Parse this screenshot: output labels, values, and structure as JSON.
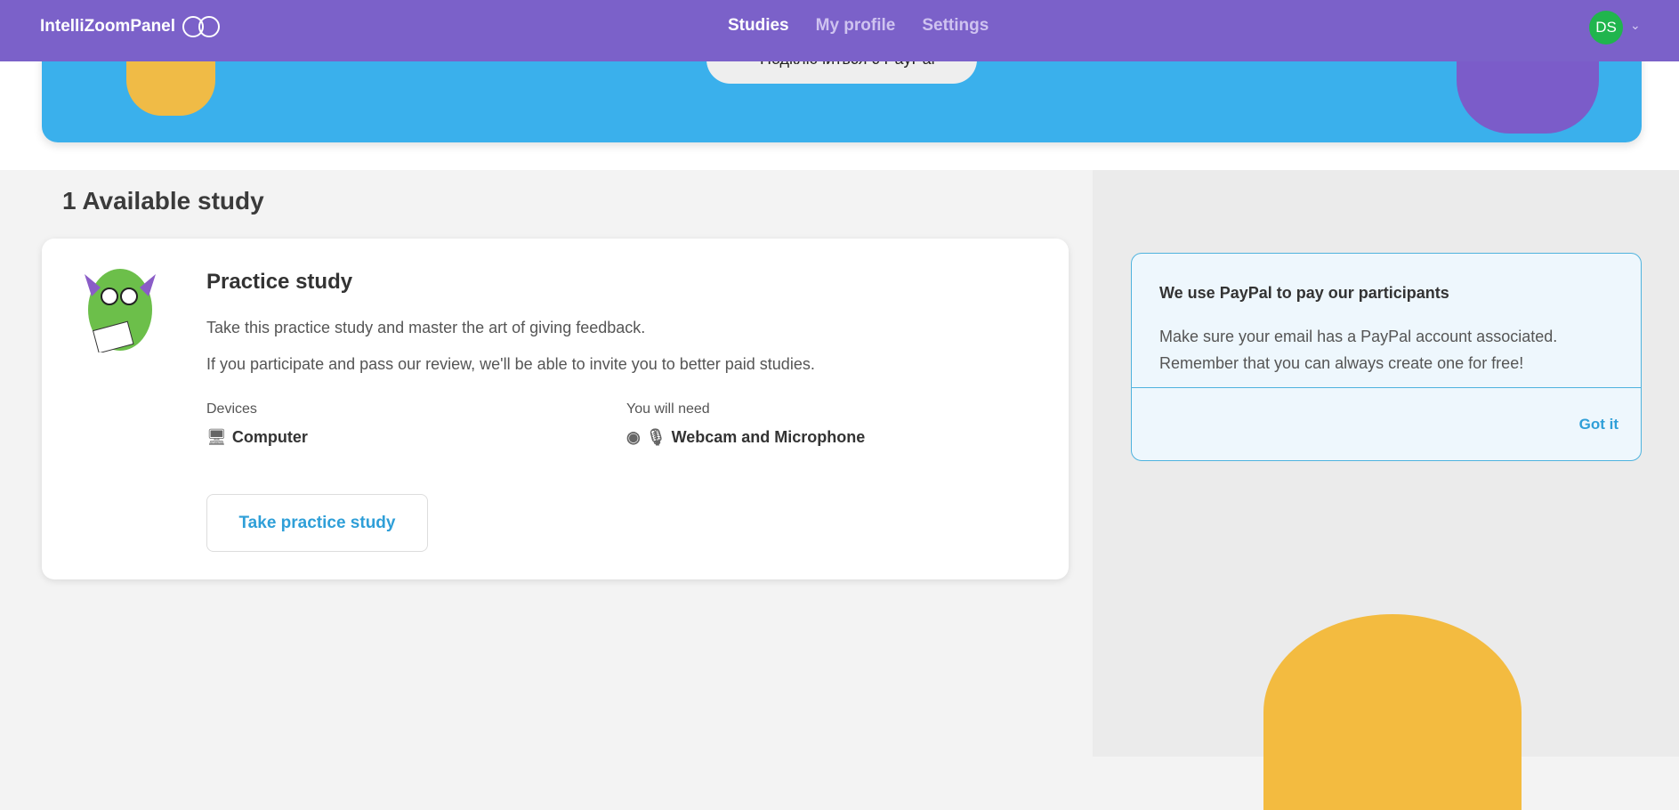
{
  "nav": {
    "brand": "IntelliZoomPanel",
    "links": [
      "Studies",
      "My profile",
      "Settings"
    ],
    "active": "Studies",
    "avatar_initials": "DS"
  },
  "banner": {
    "button_label": "Подключиться с PayPal"
  },
  "studies": {
    "heading": "1 Available study",
    "card": {
      "title": "Practice study",
      "description_1": "Take this practice study and master the art of giving feedback.",
      "description_2": "If you participate and pass our review, we'll be able to invite you to better paid studies.",
      "devices_label": "Devices",
      "devices_value": "Computer",
      "need_label": "You will need",
      "need_value": "Webcam and Microphone",
      "button": "Take practice study"
    }
  },
  "paypal_notice": {
    "title": "We use PayPal to pay our participants",
    "text": "Make sure your email has a PayPal account associated. Remember that you can always create one for free!",
    "action": "Got it"
  },
  "colors": {
    "nav": "#7b61c9",
    "banner": "#3ab0ec",
    "accent": "#2f9fd8",
    "avatar": "#20b54d"
  }
}
